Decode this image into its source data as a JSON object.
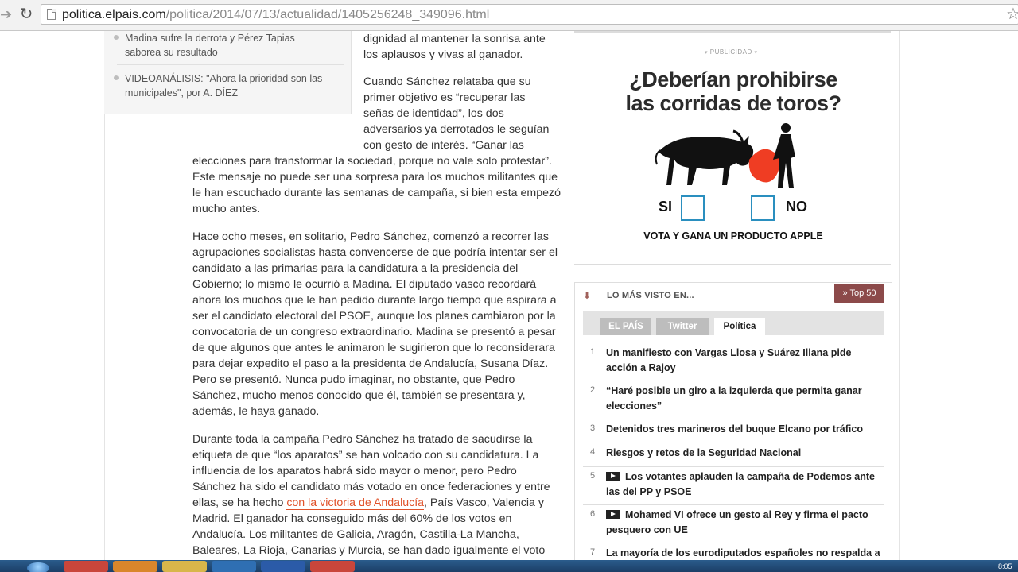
{
  "browser": {
    "url_host": "politica.elpais.com",
    "url_path": "/politica/2014/07/13/actualidad/1405256248_349096.html"
  },
  "related": [
    "Madina sufre la derrota y Pérez Tapias saborea su resultado",
    "VIDEOANÁLISIS: \"Ahora la prioridad son las municipales\", por A. DÍEZ"
  ],
  "article": {
    "p0_l1": "dignidad al mantener la sonrisa ante",
    "p0_l2": "los aplausos y vivas al ganador.",
    "p1_l1": "Cuando Sánchez relataba que su",
    "p1_l2": "primer objetivo es “recuperar las",
    "p1_l3": "señas de identidad”, los dos",
    "p1_l4": "adversarios ya derrotados le seguían",
    "p1_l5": "con gesto de interés. “Ganar las",
    "p1_rest": "elecciones para transformar la sociedad, porque no vale solo protestar”. Este mensaje no puede ser una sorpresa para los muchos militantes que le han escuchado durante las semanas de campaña, si bien esta empezó mucho antes.",
    "p2": "Hace ocho meses, en solitario, Pedro Sánchez, comenzó a recorrer las agrupaciones socialistas hasta convencerse de que podría intentar ser el candidato a las primarias para la candidatura a la presidencia del Gobierno; lo mismo le ocurrió a Madina. El diputado vasco recordará ahora los muchos que le han pedido durante largo tiempo que aspirara a ser el candidato electoral del PSOE, aunque los planes cambiaron por la convocatoria de un congreso extraordinario. Madina se presentó a pesar de que algunos que antes le animaron le sugirieron que lo reconsiderara para dejar expedito el paso a la presidenta de Andalucía, Susana Díaz. Pero se presentó. Nunca pudo imaginar, no obstante, que Pedro Sánchez, mucho menos conocido que él, también se presentara y, además, le haya ganado.",
    "p3_a": "Durante toda la campaña Pedro Sánchez ha tratado de sacudirse la etiqueta de que “los aparatos” se han volcado con su candidatura. La influencia de los aparatos habrá sido mayor o menor, pero Pedro Sánchez ha sido el candidato más votado en once federaciones y entre ellas, se ha hecho ",
    "p3_link": "con la victoria de Andalucía",
    "p3_b": ", País Vasco, Valencia y Madrid. El ganador ha conseguido más del 60% de los votos en Andalucía. Los militantes de Galicia, Aragón, Castilla-La Mancha, Baleares, La Rioja, Canarias y Murcia, se han dado igualmente el voto"
  },
  "ad": {
    "label": "PUBLICIDAD",
    "question_l1": "¿Deberían prohibirse",
    "question_l2": "las corridas de toros?",
    "yes": "SI",
    "no": "NO",
    "cta": "VOTA Y  GANA UN PRODUCTO APPLE"
  },
  "most_viewed": {
    "title": "LO MÁS VISTO EN...",
    "top50": "» Top 50",
    "tabs": [
      "EL PAÍS",
      "Twitter",
      "Política"
    ],
    "items": [
      {
        "n": "1",
        "text": "Un manifiesto con Vargas Llosa y Suárez Illana pide acción a Rajoy"
      },
      {
        "n": "2",
        "text": "“Haré posible un giro a la izquierda que permita ganar elecciones”"
      },
      {
        "n": "3",
        "text": "Detenidos tres marineros del buque Elcano por tráfico"
      },
      {
        "n": "4",
        "text": "Riesgos y retos de la Seguridad Nacional"
      },
      {
        "n": "5",
        "text": "Los votantes aplauden la campaña de Podemos ante las del PP y PSOE"
      },
      {
        "n": "6",
        "text": "Mohamed VI ofrece un gesto al Rey y firma el pacto pesquero con UE"
      },
      {
        "n": "7",
        "text": "La mayoría de los eurodiputados españoles no respalda a"
      }
    ]
  },
  "taskbar": {
    "clock": "8:05"
  }
}
